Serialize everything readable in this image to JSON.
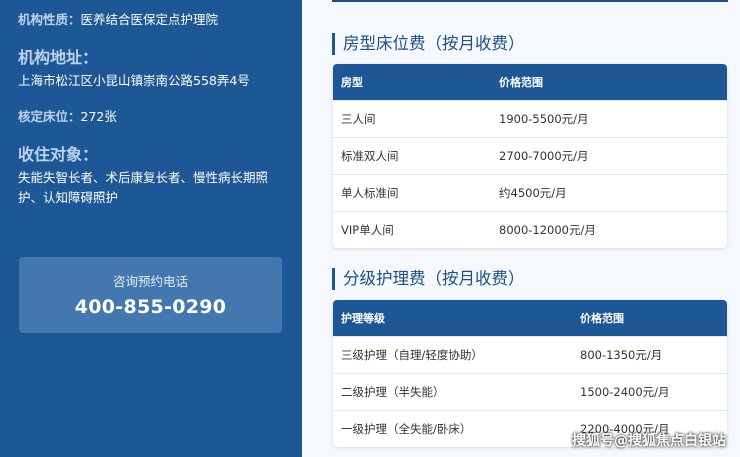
{
  "sidebar": {
    "nature": {
      "key": "机构性质：",
      "value": "医养结合医保定点护理院"
    },
    "address": {
      "key": "机构地址：",
      "value": "上海市松江区小昆山镇崇南公路558弄4号"
    },
    "beds": {
      "key": "核定床位：",
      "value": "272张"
    },
    "targets": {
      "key": "收住对象：",
      "value": "失能失智长者、术后康复长者、慢性病长期照护、认知障碍照护"
    },
    "contact": {
      "label": "咨询预约电话",
      "phone": "400-855-0290"
    }
  },
  "room_fees": {
    "title": "房型床位费（按月收费）",
    "headers": [
      "房型",
      "价格范围"
    ],
    "rows": [
      [
        "三人间",
        "1900-5500元/月"
      ],
      [
        "标准双人间",
        "2700-7000元/月"
      ],
      [
        "单人标准间",
        "约4500元/月"
      ],
      [
        "VIP单人间",
        "8000-12000元/月"
      ]
    ]
  },
  "care_fees": {
    "title": "分级护理费（按月收费）",
    "headers": [
      "护理等级",
      "价格范围"
    ],
    "rows": [
      [
        "三级护理（自理/轻度协助）",
        "800-1350元/月"
      ],
      [
        "二级护理（半失能）",
        "1500-2400元/月"
      ],
      [
        "一级护理（全失能/卧床）",
        "2200-4000元/月"
      ]
    ]
  },
  "watermark": "搜狐号@搜狐焦点白银站",
  "colors": {
    "sidebar_bg": "#1d5796",
    "header_bg": "#1d5796",
    "card_bg": "#4277b0",
    "title_text": "#1d4f88"
  }
}
